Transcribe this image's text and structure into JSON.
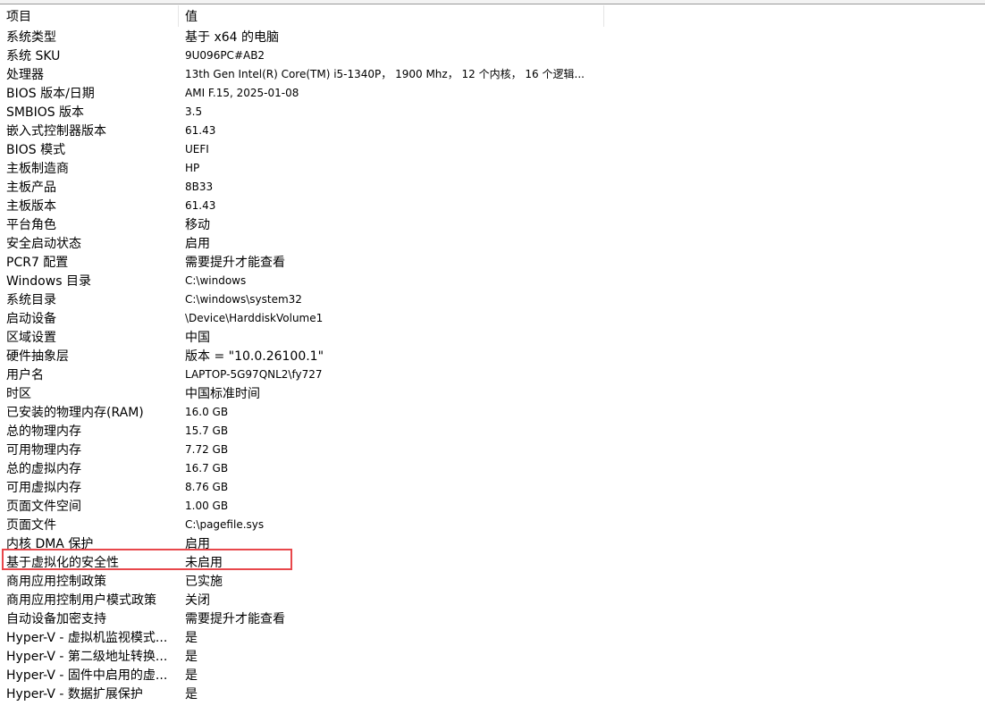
{
  "header": {
    "item": "项目",
    "value": "值"
  },
  "rows": [
    {
      "item": "系统类型",
      "value": "基于 x64 的电脑",
      "cjk": true
    },
    {
      "item": "系统 SKU",
      "value": "9U096PC#AB2",
      "cjk": false
    },
    {
      "item": "处理器",
      "value": "13th Gen Intel(R) Core(TM) i5-1340P， 1900 Mhz， 12 个内核， 16 个逻辑...",
      "cjk": false
    },
    {
      "item": "BIOS 版本/日期",
      "value": "AMI F.15, 2025-01-08",
      "cjk": false
    },
    {
      "item": "SMBIOS 版本",
      "value": "3.5",
      "cjk": false
    },
    {
      "item": "嵌入式控制器版本",
      "value": "61.43",
      "cjk": false
    },
    {
      "item": "BIOS 模式",
      "value": "UEFI",
      "cjk": false
    },
    {
      "item": "主板制造商",
      "value": "HP",
      "cjk": false
    },
    {
      "item": "主板产品",
      "value": "8B33",
      "cjk": false
    },
    {
      "item": "主板版本",
      "value": "61.43",
      "cjk": false
    },
    {
      "item": "平台角色",
      "value": "移动",
      "cjk": true
    },
    {
      "item": "安全启动状态",
      "value": "启用",
      "cjk": true
    },
    {
      "item": "PCR7 配置",
      "value": "需要提升才能查看",
      "cjk": true
    },
    {
      "item": "Windows 目录",
      "value": "C:\\windows",
      "cjk": false
    },
    {
      "item": "系统目录",
      "value": "C:\\windows\\system32",
      "cjk": false
    },
    {
      "item": "启动设备",
      "value": "\\Device\\HarddiskVolume1",
      "cjk": false
    },
    {
      "item": "区域设置",
      "value": "中国",
      "cjk": true
    },
    {
      "item": "硬件抽象层",
      "value": "版本 = \"10.0.26100.1\"",
      "cjk": true
    },
    {
      "item": "用户名",
      "value": "LAPTOP-5G97QNL2\\fy727",
      "cjk": false
    },
    {
      "item": "时区",
      "value": "中国标准时间",
      "cjk": true
    },
    {
      "item": "已安装的物理内存(RAM)",
      "value": "16.0 GB",
      "cjk": false
    },
    {
      "item": "总的物理内存",
      "value": "15.7 GB",
      "cjk": false
    },
    {
      "item": "可用物理内存",
      "value": "7.72 GB",
      "cjk": false
    },
    {
      "item": "总的虚拟内存",
      "value": "16.7 GB",
      "cjk": false
    },
    {
      "item": "可用虚拟内存",
      "value": "8.76 GB",
      "cjk": false
    },
    {
      "item": "页面文件空间",
      "value": "1.00 GB",
      "cjk": false
    },
    {
      "item": "页面文件",
      "value": "C:\\pagefile.sys",
      "cjk": false
    },
    {
      "item": "内核 DMA 保护",
      "value": "启用",
      "cjk": true
    },
    {
      "item": "基于虚拟化的安全性",
      "value": "未启用",
      "cjk": true
    },
    {
      "item": "商用应用控制政策",
      "value": "已实施",
      "cjk": true
    },
    {
      "item": "商用应用控制用户模式政策",
      "value": "关闭",
      "cjk": true
    },
    {
      "item": "自动设备加密支持",
      "value": "需要提升才能查看",
      "cjk": true
    },
    {
      "item": "Hyper-V - 虚拟机监视模式...",
      "value": "是",
      "cjk": true
    },
    {
      "item": "Hyper-V - 第二级地址转换...",
      "value": "是",
      "cjk": true
    },
    {
      "item": "Hyper-V - 固件中启用的虚...",
      "value": "是",
      "cjk": true
    },
    {
      "item": "Hyper-V - 数据扩展保护",
      "value": "是",
      "cjk": true
    }
  ],
  "highlight": {
    "color": "#e8474b",
    "row_item": "基于虚拟化的安全性"
  }
}
